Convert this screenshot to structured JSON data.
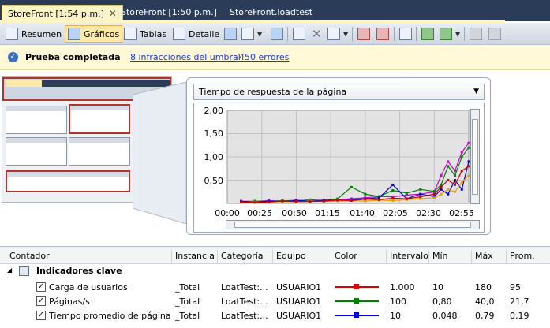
{
  "tabs": [
    {
      "label": "StoreFront [1:54 p.m.]",
      "active": true
    },
    {
      "label": "StoreFront [1:50 p.m.]",
      "active": false
    },
    {
      "label": "StoreFront.loadtest",
      "active": false
    }
  ],
  "toolbar": {
    "summary_label": "Resumen",
    "graphs_label": "Gráficos",
    "tables_label": "Tablas",
    "detail_label": "Detalle"
  },
  "infobar": {
    "status": "Prueba completada",
    "thresholds_link": "8 infracciones del umbral",
    "errors_link": "450 errores"
  },
  "graph": {
    "selected": "Tiempo de respuesta de la página"
  },
  "chart_data": {
    "type": "line",
    "title": "Tiempo de respuesta de la página",
    "x_ticks": [
      "00:00",
      "00:25",
      "00:50",
      "01:15",
      "01:40",
      "02:05",
      "02:30",
      "02:55"
    ],
    "y_ticks": [
      "2,00",
      "1,50",
      "1,00",
      "0,50"
    ],
    "ylim": [
      0,
      2.0
    ],
    "xlim": [
      0,
      175
    ],
    "grid": true,
    "series": [
      {
        "color": "#cc00cc",
        "x": [
          10,
          20,
          30,
          40,
          50,
          60,
          70,
          80,
          90,
          100,
          110,
          120,
          130,
          140,
          150,
          155,
          160,
          165,
          170,
          175
        ],
        "y": [
          0.05,
          0.04,
          0.06,
          0.05,
          0.07,
          0.05,
          0.06,
          0.08,
          0.1,
          0.12,
          0.15,
          0.14,
          0.18,
          0.2,
          0.25,
          0.6,
          0.9,
          0.7,
          1.1,
          1.3
        ]
      },
      {
        "color": "#008000",
        "x": [
          10,
          20,
          30,
          40,
          50,
          60,
          70,
          80,
          90,
          100,
          110,
          120,
          130,
          140,
          150,
          155,
          160,
          165,
          170,
          175
        ],
        "y": [
          0.03,
          0.05,
          0.04,
          0.06,
          0.05,
          0.08,
          0.06,
          0.1,
          0.35,
          0.2,
          0.15,
          0.28,
          0.22,
          0.3,
          0.26,
          0.4,
          0.8,
          0.6,
          1.0,
          1.2
        ]
      },
      {
        "color": "#0000dd",
        "x": [
          10,
          20,
          30,
          40,
          50,
          60,
          70,
          80,
          90,
          100,
          110,
          120,
          130,
          140,
          150,
          155,
          160,
          165,
          170,
          175
        ],
        "y": [
          0.04,
          0.03,
          0.05,
          0.04,
          0.06,
          0.05,
          0.07,
          0.06,
          0.08,
          0.1,
          0.12,
          0.4,
          0.1,
          0.2,
          0.15,
          0.3,
          0.2,
          0.5,
          0.3,
          0.9
        ]
      },
      {
        "color": "#e8a000",
        "x": [
          10,
          20,
          30,
          40,
          50,
          60,
          70,
          80,
          90,
          100,
          110,
          120,
          130,
          140,
          150,
          155,
          160,
          165,
          170,
          175
        ],
        "y": [
          0.02,
          0.03,
          0.02,
          0.04,
          0.03,
          0.05,
          0.04,
          0.05,
          0.06,
          0.05,
          0.07,
          0.06,
          0.08,
          0.1,
          0.12,
          0.2,
          0.3,
          0.25,
          0.45,
          0.6
        ]
      },
      {
        "color": "#cc0000",
        "x": [
          10,
          20,
          30,
          40,
          50,
          60,
          70,
          80,
          90,
          100,
          110,
          120,
          130,
          140,
          150,
          155,
          160,
          165,
          170,
          175
        ],
        "y": [
          0.03,
          0.02,
          0.03,
          0.05,
          0.04,
          0.04,
          0.05,
          0.07,
          0.06,
          0.09,
          0.08,
          0.11,
          0.1,
          0.14,
          0.2,
          0.35,
          0.5,
          0.4,
          0.7,
          0.8
        ]
      }
    ]
  },
  "table": {
    "headers": [
      "Contador",
      "Instancia",
      "Categoría",
      "Equipo",
      "Color",
      "Intervalo",
      "Mín",
      "Máx",
      "Prom."
    ],
    "group": "Indicadores clave",
    "rows": [
      {
        "counter": "Carga de usuarios",
        "instance": "_Total",
        "category": "LoatTest:...",
        "machine": "USUARIO1",
        "color": "#dd0000",
        "interval": "1.000",
        "min": "10",
        "max": "180",
        "avg": "95"
      },
      {
        "counter": "Páginas/s",
        "instance": "_Total",
        "category": "LoatTest:...",
        "machine": "USUARIO1",
        "color": "#008000",
        "interval": "100",
        "min": "0,80",
        "max": "40,0",
        "avg": "21,7"
      },
      {
        "counter": "Tiempo promedio de página",
        "instance": "_Total",
        "category": "LoatTest:...",
        "machine": "USUARIO1",
        "color": "#0000dd",
        "interval": "10",
        "min": "0,048",
        "max": "0,79",
        "avg": "0,19"
      }
    ]
  }
}
